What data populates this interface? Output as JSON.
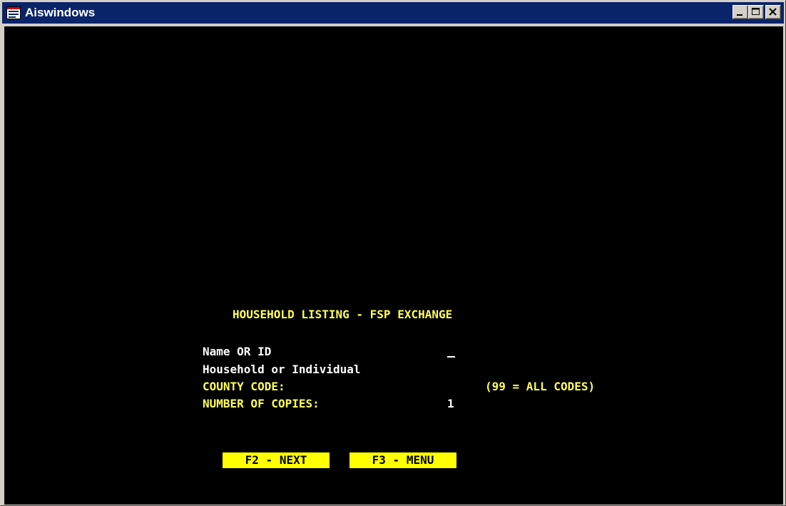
{
  "window": {
    "title": "Aiswindows",
    "icon": "app-window-icon",
    "buttons": [
      "minimize-icon",
      "maximize-icon",
      "close-icon"
    ]
  },
  "screen": {
    "heading": "HOUSEHOLD LISTING - FSP EXCHANGE",
    "fields": {
      "name_or_id_label": "Name OR ID",
      "household_or_individual_label": "Household or Individual",
      "county_code_label": "COUNTY CODE:",
      "county_code_hint": "(99 = ALL CODES)",
      "copies_label": "NUMBER OF COPIES:",
      "copies_value": "1"
    },
    "function_keys": {
      "next_label": " F2 - NEXT ",
      "menu_label": " F3 - MENU "
    }
  },
  "colors": {
    "console_background": "#000000",
    "heading_text": "#ffff55",
    "field_label_text": "#ffff55",
    "value_text": "#ffffff",
    "function_key_background": "#ffff00",
    "function_key_text": "#000000",
    "titlebar": "#0a246a"
  }
}
